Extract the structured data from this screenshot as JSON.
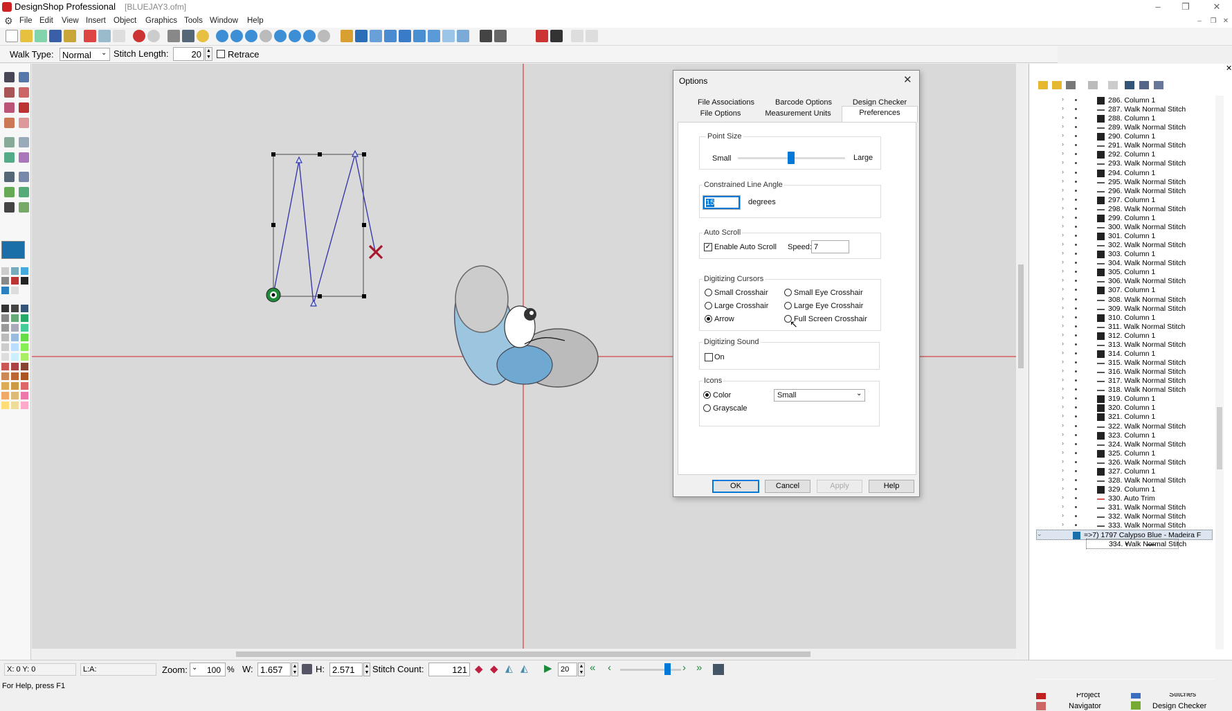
{
  "app": {
    "title": "DesignShop Professional",
    "file": "[BLUEJAY3.ofm]"
  },
  "window_controls": {
    "minimize": "–",
    "restore": "❐",
    "close": "✕",
    "doc_minimize": "–",
    "doc_restore": "❐",
    "doc_close": "✕"
  },
  "menu": [
    "File",
    "Edit",
    "View",
    "Insert",
    "Object",
    "Graphics",
    "Tools",
    "Window",
    "Help"
  ],
  "toolbar2": {
    "walk_type_label": "Walk Type:",
    "walk_type_value": "Normal",
    "stitch_length_label": "Stitch Length:",
    "stitch_length_value": "20",
    "retrace_label": "Retrace"
  },
  "dialog": {
    "title": "Options",
    "close": "✕",
    "tabs_row1": [
      "File Associations",
      "Barcode Options",
      "Design Checker"
    ],
    "tabs_row2": [
      "File Options",
      "Measurement Units",
      "Preferences"
    ],
    "point_size": {
      "label": "Point Size",
      "small": "Small",
      "large": "Large",
      "level": 0.5
    },
    "constrained": {
      "label": "Constrained Line Angle",
      "value": "15",
      "unit": "degrees"
    },
    "autoscroll": {
      "label": "Auto Scroll",
      "enable_label": "Enable Auto Scroll",
      "enabled": true,
      "speed_label": "Speed:",
      "speed_value": "7"
    },
    "cursors": {
      "label": "Digitizing Cursors",
      "options": [
        "Small Crosshair",
        "Small Eye Crosshair",
        "Large Crosshair",
        "Large Eye Crosshair",
        "Arrow",
        "Full Screen Crosshair"
      ],
      "selected": "Arrow"
    },
    "sound": {
      "label": "Digitizing Sound",
      "on_label": "On"
    },
    "icons": {
      "label": "Icons",
      "color_label": "Color",
      "grayscale_label": "Grayscale",
      "size_value": "Small"
    },
    "buttons": {
      "ok": "OK",
      "cancel": "Cancel",
      "apply": "Apply",
      "help": "Help"
    }
  },
  "tree": {
    "items": [
      {
        "label": "286. Column 1"
      },
      {
        "label": "287. Walk Normal Stitch"
      },
      {
        "label": "288. Column 1"
      },
      {
        "label": "289. Walk Normal Stitch"
      },
      {
        "label": "290. Column 1"
      },
      {
        "label": "291. Walk Normal Stitch"
      },
      {
        "label": "292. Column 1"
      },
      {
        "label": "293. Walk Normal Stitch"
      },
      {
        "label": "294. Column 1"
      },
      {
        "label": "295. Walk Normal Stitch"
      },
      {
        "label": "296. Walk Normal Stitch"
      },
      {
        "label": "297. Column 1"
      },
      {
        "label": "298. Walk Normal Stitch"
      },
      {
        "label": "299. Column 1"
      },
      {
        "label": "300. Walk Normal Stitch"
      },
      {
        "label": "301. Column 1"
      },
      {
        "label": "302. Walk Normal Stitch"
      },
      {
        "label": "303. Column 1"
      },
      {
        "label": "304. Walk Normal Stitch"
      },
      {
        "label": "305. Column 1"
      },
      {
        "label": "306. Walk Normal Stitch"
      },
      {
        "label": "307. Column 1"
      },
      {
        "label": "308. Walk Normal Stitch"
      },
      {
        "label": "309. Walk Normal Stitch"
      },
      {
        "label": "310. Column 1"
      },
      {
        "label": "311. Walk Normal Stitch"
      },
      {
        "label": "312. Column 1"
      },
      {
        "label": "313. Walk Normal Stitch"
      },
      {
        "label": "314. Column 1"
      },
      {
        "label": "315. Walk Normal Stitch"
      },
      {
        "label": "316. Walk Normal Stitch"
      },
      {
        "label": "317. Walk Normal Stitch"
      },
      {
        "label": "318. Walk Normal Stitch"
      },
      {
        "label": "319. Column 1"
      },
      {
        "label": "320. Column 1"
      },
      {
        "label": "321. Column 1"
      },
      {
        "label": "322. Walk Normal Stitch"
      },
      {
        "label": "323. Column 1"
      },
      {
        "label": "324. Walk Normal Stitch"
      },
      {
        "label": "325. Column 1"
      },
      {
        "label": "326. Walk Normal Stitch"
      },
      {
        "label": "327. Column 1"
      },
      {
        "label": "328. Walk Normal Stitch"
      },
      {
        "label": "329. Column 1"
      },
      {
        "label": "330. Auto Trim"
      },
      {
        "label": "331. Walk Normal Stitch"
      },
      {
        "label": "332. Walk Normal Stitch"
      },
      {
        "label": "333. Walk Normal Stitch"
      },
      {
        "label": "=>7) 1797 Calypso Blue - Madeira F"
      },
      {
        "label": "334. Walk Normal Stitch"
      }
    ]
  },
  "panel_tabs": {
    "project": "Project",
    "stitches": "Stitches",
    "navigator": "Navigator",
    "design_checker": "Design Checker"
  },
  "status": {
    "coords": "X: 0 Y: 0",
    "length": "L:A:",
    "zoom_label": "Zoom:",
    "zoom_value": "100",
    "zoom_unit": "%",
    "w_label": "W:",
    "w_value": "1.657",
    "h_label": "H:",
    "h_value": "2.571",
    "stitch_count_label": "Stitch Count:",
    "stitch_count_value": "121",
    "step_value": "20"
  },
  "help": "For Help, press F1",
  "colors": {
    "accent": "#0078d7",
    "walk_line": "#3a3aa8",
    "crosshair": "#d21f1f",
    "trim_x": "#a8182c"
  }
}
